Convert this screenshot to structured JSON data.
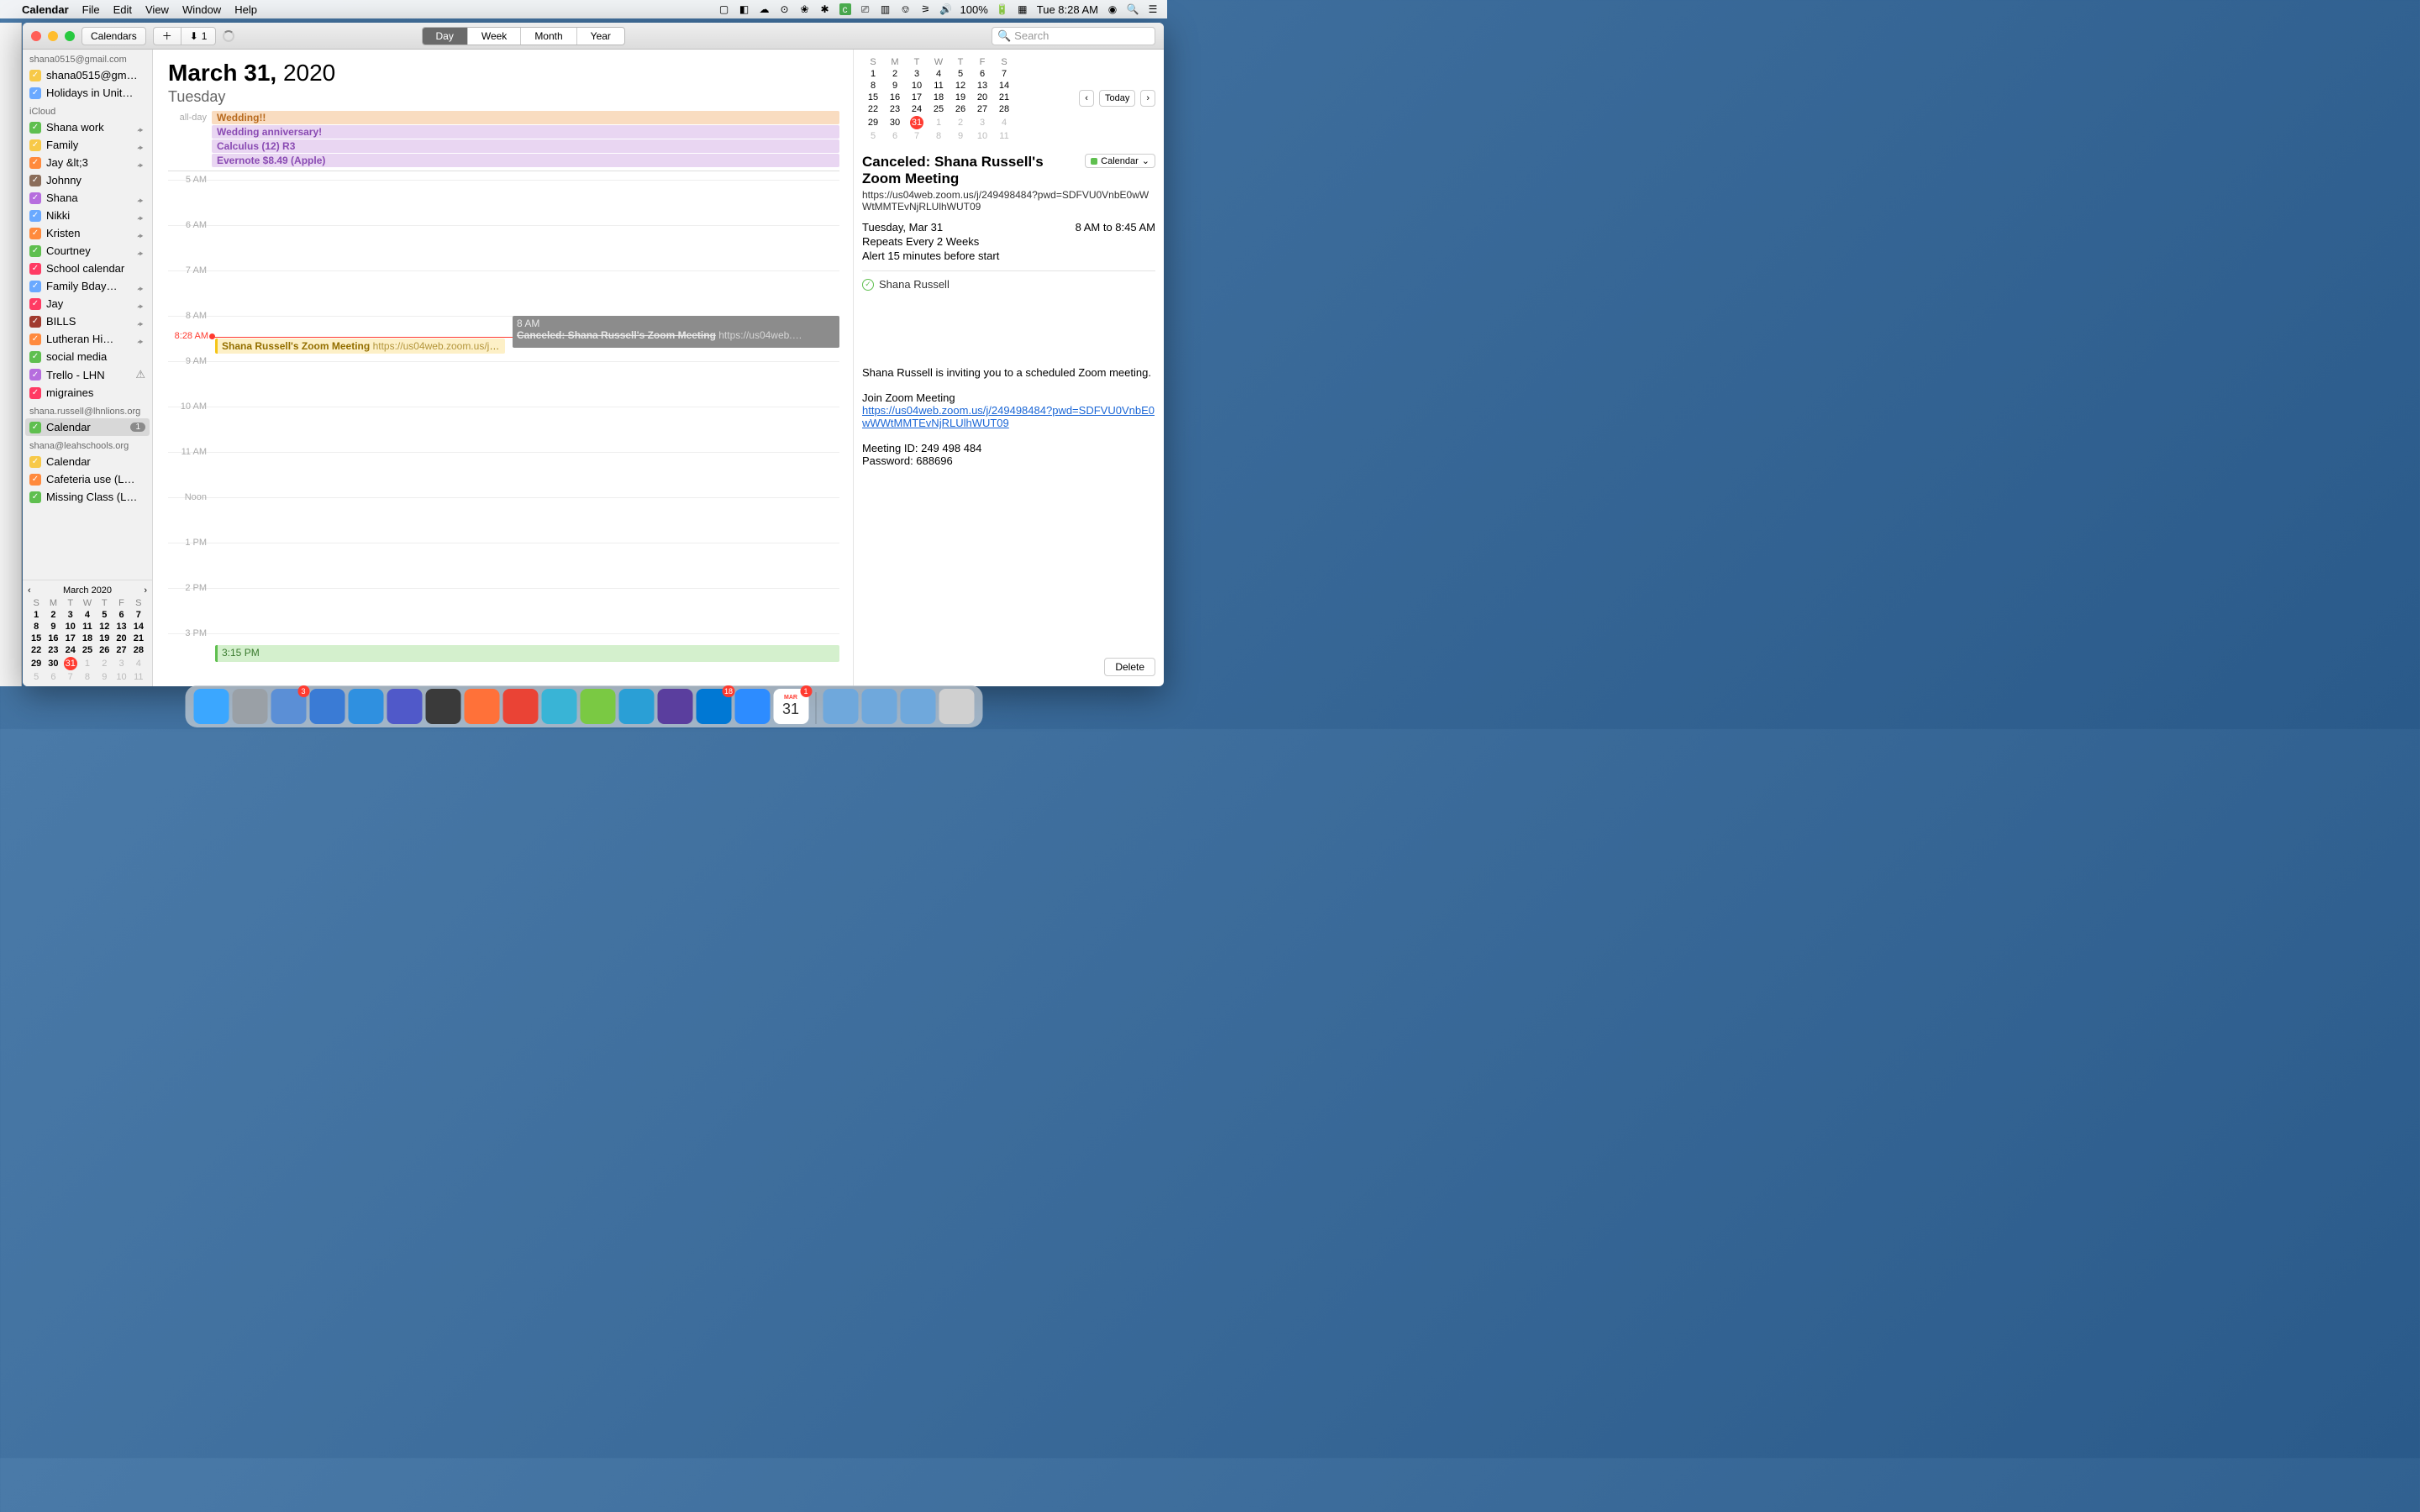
{
  "menubar": {
    "app": "Calendar",
    "items": [
      "File",
      "Edit",
      "View",
      "Window",
      "Help"
    ],
    "battery": "100%",
    "clock": "Tue 8:28 AM"
  },
  "toolbar": {
    "calendars_btn": "Calendars",
    "inbox_count": "1",
    "views": [
      "Day",
      "Week",
      "Month",
      "Year"
    ],
    "active_view": "Day",
    "search_placeholder": "Search"
  },
  "sidebar": {
    "sections": [
      {
        "title": "shana0515@gmail.com",
        "items": [
          {
            "label": "shana0515@gm…",
            "color": "#f7c948",
            "checked": true
          },
          {
            "label": "Holidays in Unit…",
            "color": "#6aa9ff",
            "checked": true
          }
        ]
      },
      {
        "title": "iCloud",
        "items": [
          {
            "label": "Shana work",
            "color": "#5fbf4f",
            "checked": true,
            "shared": true
          },
          {
            "label": "Family",
            "color": "#f7c948",
            "checked": true,
            "shared": true
          },
          {
            "label": "Jay &lt;3",
            "color": "#ff8a3d",
            "checked": true,
            "shared": true
          },
          {
            "label": "Johnny",
            "color": "#8a6d5a",
            "checked": true
          },
          {
            "label": "Shana",
            "color": "#b66dde",
            "checked": true,
            "shared": true
          },
          {
            "label": "Nikki",
            "color": "#6aa9ff",
            "checked": true,
            "shared": true
          },
          {
            "label": "Kristen",
            "color": "#ff8a3d",
            "checked": true,
            "shared": true
          },
          {
            "label": "Courtney",
            "color": "#5fbf4f",
            "checked": true,
            "shared": true
          },
          {
            "label": "School calendar",
            "color": "#ff3b63",
            "checked": true
          },
          {
            "label": "Family Bday…",
            "color": "#6aa9ff",
            "checked": true,
            "shared": true
          },
          {
            "label": "Jay",
            "color": "#ff3b63",
            "checked": true,
            "shared": true
          },
          {
            "label": "BILLS",
            "color": "#a03a2e",
            "checked": true,
            "shared": true
          },
          {
            "label": "Lutheran Hi…",
            "color": "#ff8a3d",
            "checked": true,
            "shared": true
          },
          {
            "label": "social media",
            "color": "#5fbf4f",
            "checked": true
          },
          {
            "label": "Trello - LHN",
            "color": "#b66dde",
            "checked": true,
            "warn": true
          },
          {
            "label": "migraines",
            "color": "#ff3b63",
            "checked": true
          }
        ]
      },
      {
        "title": "shana.russell@lhnlions.org",
        "items": [
          {
            "label": "Calendar",
            "color": "#5fbf4f",
            "checked": true,
            "badge": "1",
            "selected": true
          }
        ]
      },
      {
        "title": "shana@leahschools.org",
        "items": [
          {
            "label": "Calendar",
            "color": "#f7c948",
            "checked": true
          },
          {
            "label": "Cafeteria use (L…",
            "color": "#ff8a3d",
            "checked": true
          },
          {
            "label": "Missing Class (L…",
            "color": "#5fbf4f",
            "checked": true
          }
        ]
      }
    ],
    "minical": {
      "title": "March 2020",
      "dow": [
        "S",
        "M",
        "T",
        "W",
        "T",
        "F",
        "S"
      ],
      "rows": [
        [
          {
            "n": "1",
            "b": 1
          },
          {
            "n": "2",
            "b": 1
          },
          {
            "n": "3",
            "b": 1
          },
          {
            "n": "4",
            "b": 1
          },
          {
            "n": "5",
            "b": 1
          },
          {
            "n": "6",
            "b": 1
          },
          {
            "n": "7",
            "b": 1
          }
        ],
        [
          {
            "n": "8",
            "b": 1
          },
          {
            "n": "9",
            "b": 1
          },
          {
            "n": "10",
            "b": 1
          },
          {
            "n": "11",
            "b": 1
          },
          {
            "n": "12",
            "b": 1
          },
          {
            "n": "13",
            "b": 1
          },
          {
            "n": "14",
            "b": 1
          }
        ],
        [
          {
            "n": "15",
            "b": 1
          },
          {
            "n": "16",
            "b": 1
          },
          {
            "n": "17",
            "b": 1
          },
          {
            "n": "18",
            "b": 1
          },
          {
            "n": "19",
            "b": 1
          },
          {
            "n": "20",
            "b": 1
          },
          {
            "n": "21",
            "b": 1
          }
        ],
        [
          {
            "n": "22",
            "b": 1
          },
          {
            "n": "23",
            "b": 1
          },
          {
            "n": "24",
            "b": 1
          },
          {
            "n": "25",
            "b": 1
          },
          {
            "n": "26",
            "b": 1
          },
          {
            "n": "27",
            "b": 1
          },
          {
            "n": "28",
            "b": 1
          }
        ],
        [
          {
            "n": "29",
            "b": 1
          },
          {
            "n": "30",
            "b": 1
          },
          {
            "n": "31",
            "today": 1
          },
          {
            "n": "1",
            "dim": 1
          },
          {
            "n": "2",
            "dim": 1
          },
          {
            "n": "3",
            "dim": 1
          },
          {
            "n": "4",
            "dim": 1
          }
        ],
        [
          {
            "n": "5",
            "dim": 1
          },
          {
            "n": "6",
            "dim": 1
          },
          {
            "n": "7",
            "dim": 1
          },
          {
            "n": "8",
            "dim": 1
          },
          {
            "n": "9",
            "dim": 1
          },
          {
            "n": "10",
            "dim": 1
          },
          {
            "n": "11",
            "dim": 1
          }
        ]
      ]
    }
  },
  "dayview": {
    "title_bold": "March 31,",
    "title_rest": " 2020",
    "dow": "Tuesday",
    "allday_label": "all-day",
    "allday_events": [
      {
        "label": "Wedding!!",
        "bg": "#f9dcc0",
        "fg": "#b86a1e"
      },
      {
        "label": "Wedding anniversary!",
        "bg": "#e9d6f2",
        "fg": "#8a4bb3"
      },
      {
        "label": "Calculus (12) R3",
        "bg": "#e9d6f2",
        "fg": "#8a4bb3"
      },
      {
        "label": "Evernote $8.49 (Apple)",
        "bg": "#e9d6f2",
        "fg": "#8a4bb3"
      }
    ],
    "hours": [
      "5 AM",
      "6 AM",
      "7 AM",
      "8 AM",
      "9 AM",
      "10 AM",
      "11 AM",
      "Noon",
      "1 PM",
      "2 PM",
      "3 PM"
    ],
    "now_label": "8:28 AM",
    "event1_title": "Shana Russell's Zoom Meeting",
    "event1_sub": "https://us04web.zoom.us/j/…",
    "event2_time": "8 AM",
    "event2_title": "Canceled: Shana Russell's Zoom Meeting",
    "event2_sub": "https://us04web.…",
    "event3_time": "3:15 PM"
  },
  "rpanel": {
    "today_btn": "Today",
    "cal": {
      "dow": [
        "S",
        "M",
        "T",
        "W",
        "T",
        "F",
        "S"
      ],
      "rows": [
        [
          {
            "n": "1"
          },
          {
            "n": "2"
          },
          {
            "n": "3"
          },
          {
            "n": "4"
          },
          {
            "n": "5"
          },
          {
            "n": "6"
          },
          {
            "n": "7"
          }
        ],
        [
          {
            "n": "8"
          },
          {
            "n": "9"
          },
          {
            "n": "10"
          },
          {
            "n": "11"
          },
          {
            "n": "12"
          },
          {
            "n": "13"
          },
          {
            "n": "14"
          }
        ],
        [
          {
            "n": "15"
          },
          {
            "n": "16"
          },
          {
            "n": "17"
          },
          {
            "n": "18"
          },
          {
            "n": "19"
          },
          {
            "n": "20"
          },
          {
            "n": "21"
          }
        ],
        [
          {
            "n": "22"
          },
          {
            "n": "23"
          },
          {
            "n": "24"
          },
          {
            "n": "25"
          },
          {
            "n": "26"
          },
          {
            "n": "27"
          },
          {
            "n": "28"
          }
        ],
        [
          {
            "n": "29"
          },
          {
            "n": "30"
          },
          {
            "n": "31",
            "today": 1
          },
          {
            "n": "1",
            "dim": 1
          },
          {
            "n": "2",
            "dim": 1
          },
          {
            "n": "3",
            "dim": 1
          },
          {
            "n": "4",
            "dim": 1
          }
        ],
        [
          {
            "n": "5",
            "dim": 1
          },
          {
            "n": "6",
            "dim": 1
          },
          {
            "n": "7",
            "dim": 1
          },
          {
            "n": "8",
            "dim": 1
          },
          {
            "n": "9",
            "dim": 1
          },
          {
            "n": "10",
            "dim": 1
          },
          {
            "n": "11",
            "dim": 1
          }
        ]
      ]
    },
    "detail": {
      "title": "Canceled: Shana Russell's Zoom Meeting",
      "calendar_label": "Calendar",
      "url": "https://us04web.zoom.us/j/249498484?pwd=SDFVU0VnbE0wWWtMMTEvNjRLUlhWUT09",
      "date": "Tuesday, Mar 31",
      "time": "8 AM to 8:45 AM",
      "repeat": "Repeats Every 2 Weeks",
      "alert": "Alert 15 minutes before start",
      "attendee": "Shana Russell",
      "notes_intro": "Shana Russell is inviting you to a scheduled Zoom meeting.",
      "notes_join": "Join Zoom Meeting",
      "notes_link": "https://us04web.zoom.us/j/249498484?pwd=SDFVU0VnbE0wWWtMMTEvNjRLUlhWUT09",
      "notes_id": "Meeting ID: 249 498 484",
      "notes_pw": "Password: 688696",
      "delete": "Delete"
    }
  },
  "dock": {
    "icons": [
      {
        "name": "finder",
        "color": "#3ba7ff"
      },
      {
        "name": "launchpad",
        "color": "#9aa0a6"
      },
      {
        "name": "todo",
        "color": "#5b8fd6",
        "badge": "3"
      },
      {
        "name": "app1",
        "color": "#3a7bd5"
      },
      {
        "name": "safari",
        "color": "#2f90e0"
      },
      {
        "name": "teams",
        "color": "#5059c9"
      },
      {
        "name": "quicktime",
        "color": "#3a3a3a"
      },
      {
        "name": "firefox",
        "color": "#ff7139"
      },
      {
        "name": "chrome",
        "color": "#ea4335"
      },
      {
        "name": "app2",
        "color": "#39b4d6"
      },
      {
        "name": "app3",
        "color": "#7ac943"
      },
      {
        "name": "app4",
        "color": "#2a9fd6"
      },
      {
        "name": "imovie",
        "color": "#5a3e9e"
      },
      {
        "name": "outlook",
        "color": "#0078d4",
        "badge": "18"
      },
      {
        "name": "zoom",
        "color": "#2d8cff"
      },
      {
        "name": "calendar",
        "color": "#fff",
        "badge": "1"
      }
    ],
    "right_icons": [
      {
        "name": "folder1",
        "color": "#6fa8dc"
      },
      {
        "name": "folder2",
        "color": "#6fa8dc"
      },
      {
        "name": "folder3",
        "color": "#6fa8dc"
      },
      {
        "name": "trash",
        "color": "#d0d0d0"
      }
    ]
  }
}
